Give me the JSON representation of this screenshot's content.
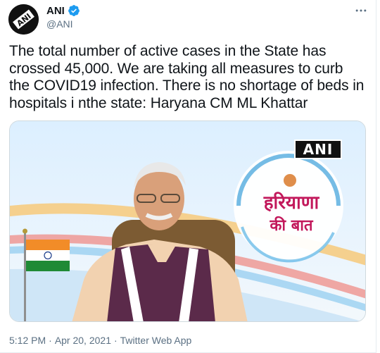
{
  "account": {
    "name": "ANI",
    "handle": "@ANI",
    "avatar_label": "ANI"
  },
  "icons": {
    "verified": "verified-badge-icon",
    "more": "more-options-icon"
  },
  "tweet": {
    "text": "The total number of active cases in the State has crossed 45,000. We are taking all measures to curb the COVID19 infection. There is no shortage of beds in hospitals i nthe state: Haryana CM ML Khattar"
  },
  "media": {
    "watermark": "ANI",
    "logo_line1": "हरियाणा",
    "logo_line2": "की बात"
  },
  "meta": {
    "time": "5:12 PM",
    "separator": "·",
    "date": "Apr 20, 2021",
    "source": "Twitter Web App"
  },
  "colors": {
    "verified_blue": "#1d9bf0",
    "secondary_text": "#5b7083",
    "logo_pink": "#c2185b"
  }
}
